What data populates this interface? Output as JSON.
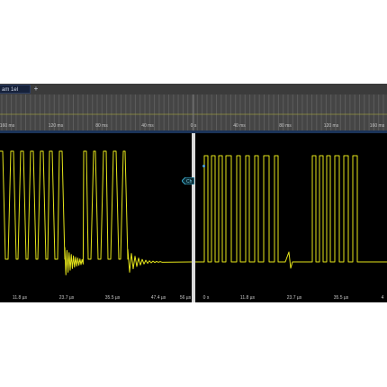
{
  "tab": {
    "label": "am 1el",
    "add_label": "+"
  },
  "overview": {
    "tick_labels": [
      "160 ms",
      "120 ms",
      "80 ms",
      "40 ms",
      "0 s",
      "40 ms",
      "80 ms",
      "120 ms",
      "160 ms"
    ]
  },
  "left_plot": {
    "x_labels": [
      "11.8 µs",
      "23.7 µs",
      "35.5 µs",
      "47.4 µs",
      "56 µs"
    ]
  },
  "right_plot": {
    "x_labels": [
      "0 s",
      "11.8 µs",
      "23.7 µs",
      "35.5 µs",
      "4"
    ]
  },
  "cursor_tag": {
    "label": "Ch"
  },
  "colors": {
    "trace": "#e6e61a",
    "background": "#000000",
    "tag": "#3aa7c7"
  }
}
